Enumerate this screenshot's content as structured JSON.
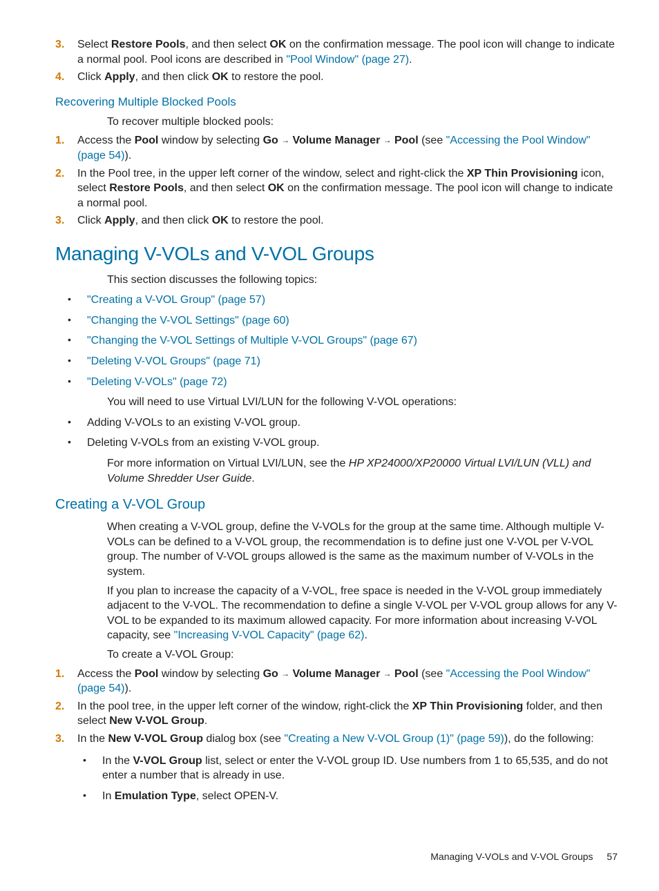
{
  "top_steps": {
    "s3_before": "Select ",
    "s3_b1": "Restore Pools",
    "s3_mid1": ", and then select ",
    "s3_b2": "OK",
    "s3_mid2": " on the confirmation message. The pool icon will change to indicate a normal pool. Pool icons are described in ",
    "s3_link": "\"Pool Window\" (page 27)",
    "s3_after": ".",
    "s4_before": "Click ",
    "s4_b1": "Apply",
    "s4_mid1": ", and then click ",
    "s4_b2": "OK",
    "s4_after": " to restore the pool."
  },
  "h3_recover": "Recovering Multiple Blocked Pools",
  "recover_intro": "To recover multiple blocked pools:",
  "recover_steps": {
    "n1": "1.",
    "n2": "2.",
    "n3": "3.",
    "s1_before": "Access the ",
    "s1_b1": "Pool",
    "s1_mid1": " window by selecting ",
    "s1_b2": "Go",
    "s1_b3": "Volume Manager",
    "s1_b4": "Pool",
    "s1_mid2": " (see ",
    "s1_link": "\"Accessing the Pool Window\" (page 54)",
    "s1_after": ").",
    "s2_before": "In the Pool tree, in the upper left corner of the window, select and right-click the ",
    "s2_b1": "XP Thin Provisioning",
    "s2_mid1": " icon, select ",
    "s2_b2": "Restore Pools",
    "s2_mid2": ", and then select ",
    "s2_b3": "OK",
    "s2_after": " on the confirmation message. The pool icon will change to indicate a normal pool.",
    "s3_before": "Click ",
    "s3_b1": "Apply",
    "s3_mid1": ", and then click ",
    "s3_b2": "OK",
    "s3_after": " to restore the pool."
  },
  "h1_manage": "Managing V-VOLs and V-VOL Groups",
  "manage_intro": "This section discusses the following topics:",
  "manage_links": {
    "l1": "\"Creating a V-VOL Group\" (page 57)",
    "l2": "\"Changing the V-VOL Settings\" (page 60)",
    "l3": "\"Changing the V-VOL Settings of Multiple V-VOL Groups\" (page 67)",
    "l4": "\"Deleting V-VOL Groups\" (page 71)",
    "l5": "\"Deleting V-VOLs\" (page 72)"
  },
  "manage_post1": "You will need to use Virtual LVI/LUN for the following V-VOL operations:",
  "manage_ops": {
    "o1": "Adding V-VOLs to an existing V-VOL group.",
    "o2": "Deleting V-VOLs from an existing V-VOL group."
  },
  "manage_post2_before": "For more information on Virtual LVI/LUN, see the ",
  "manage_post2_italic": "HP XP24000/XP20000 Virtual LVI/LUN (VLL) and Volume Shredder User Guide",
  "manage_post2_after": ".",
  "h2_create": "Creating a V-VOL Group",
  "create_p1": "When creating a V-VOL group, define the V-VOLs for the group at the same time. Although multiple V-VOLs can be defined to a V-VOL group, the recommendation is to define just one V-VOL per V-VOL group. The number of V-VOL groups allowed is the same as the maximum number of V-VOLs in the system.",
  "create_p2_before": "If you plan to increase the capacity of a V-VOL, free space is needed in the V-VOL group immediately adjacent to the V-VOL. The recommendation to define a single V-VOL per V-VOL group allows for any V-VOL to be expanded to its maximum allowed capacity. For more information about increasing V-VOL capacity, see ",
  "create_p2_link": "\"Increasing V-VOL Capacity\" (page 62)",
  "create_p2_after": ".",
  "create_intro": "To create a V-VOL Group:",
  "create_steps": {
    "n1": "1.",
    "n2": "2.",
    "n3": "3.",
    "s1_before": "Access the ",
    "s1_b1": "Pool",
    "s1_mid1": " window by selecting ",
    "s1_b2": "Go",
    "s1_b3": "Volume Manager",
    "s1_b4": "Pool",
    "s1_mid2": " (see ",
    "s1_link": "\"Accessing the Pool Window\" (page 54)",
    "s1_after": ").",
    "s2_before": "In the pool tree, in the upper left corner of the window, right-click the ",
    "s2_b1": "XP Thin Provisioning",
    "s2_mid1": " folder, and then select ",
    "s2_b2": "New V-VOL Group",
    "s2_after": ".",
    "s3_before": "In the ",
    "s3_b1": "New V-VOL Group",
    "s3_mid1": " dialog box (see ",
    "s3_link": "\"Creating a New V-VOL Group (1)\" (page 59)",
    "s3_after": "), do the following:",
    "s3_sub1_before": "In the ",
    "s3_sub1_b1": "V-VOL Group",
    "s3_sub1_after": " list, select or enter the V-VOL group ID. Use numbers from 1 to 65,535, and do not enter a number that is already in use.",
    "s3_sub2_before": "In ",
    "s3_sub2_b1": "Emulation Type",
    "s3_sub2_after": ", select OPEN-V."
  },
  "footer_text": "Managing V-VOLs and V-VOL Groups",
  "footer_page": "57",
  "nums_top": {
    "n3": "3.",
    "n4": "4."
  }
}
